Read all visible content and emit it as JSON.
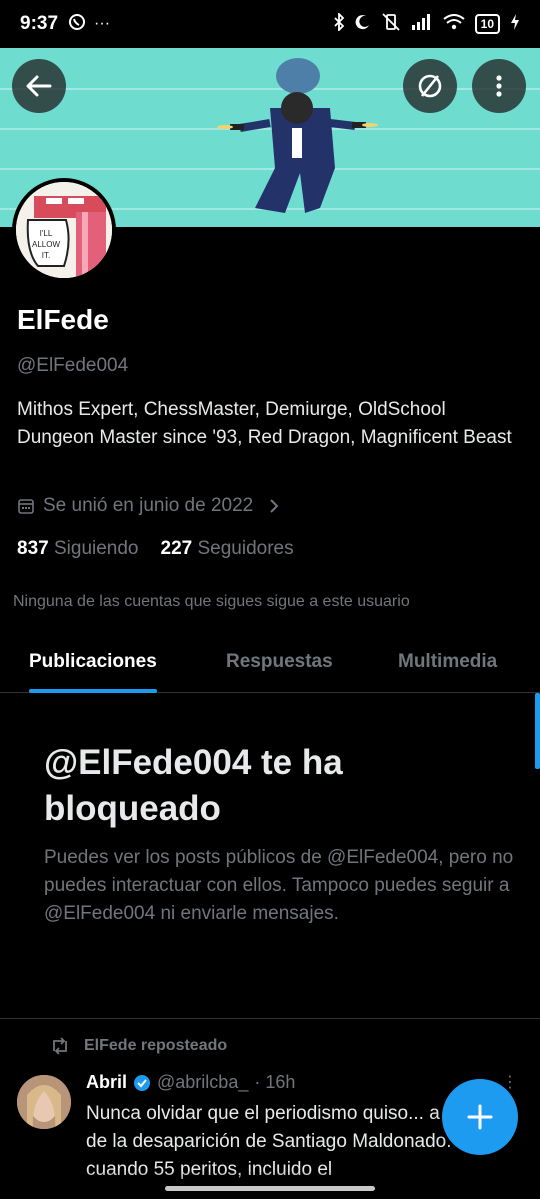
{
  "status_bar": {
    "time": "9:37",
    "left_icons": [
      "whatsapp-icon",
      "more-dots-icon"
    ],
    "right_icons": [
      "bluetooth-icon",
      "moon-icon",
      "mute-vibrate-icon",
      "signal-icon",
      "wifi-icon",
      "battery-icon",
      "charging-icon"
    ],
    "battery_level": "10"
  },
  "header": {
    "back_icon": "arrow-left-icon",
    "block_icon": "no-circle-icon",
    "more_icon": "more-vertical-icon"
  },
  "profile": {
    "avatar_text": "I'LL ALLOW IT.",
    "name": "ElFede",
    "handle": "@ElFede004",
    "bio": "Mithos Expert, ChessMaster, Demiurge, OldSchool Dungeon Master since '93, Red Dragon,  Magnificent Beast",
    "joined": "Se unió en junio de 2022",
    "following_count": "837",
    "following_label": "Siguiendo",
    "followers_count": "227",
    "followers_label": "Seguidores",
    "followers_you_know": "Ninguna de las cuentas que sigues sigue a este usuario"
  },
  "tabs": [
    {
      "label": "Publicaciones",
      "active": true
    },
    {
      "label": "Respuestas",
      "active": false
    },
    {
      "label": "Multimedia",
      "active": false
    }
  ],
  "blocked": {
    "title": "@ElFede004 te ha bloqueado",
    "text": "Puedes ver los posts públicos de @ElFede004, pero no puedes interactuar con ellos. Tampoco puedes seguir a @ElFede004 ni enviarle mensajes."
  },
  "post": {
    "repost_label": "ElFede reposteado",
    "author": "Abril",
    "verified": true,
    "handle": "@abrilcba_",
    "time": "· 16h",
    "text": "Nunca olvidar que el periodismo quiso... a Macri de la desaparición de Santiago Maldonado. Y cuando 55 peritos, incluido el"
  },
  "colors": {
    "accent": "#1d9bf0",
    "background": "#000000",
    "secondary_text": "#71767b",
    "banner": "#6fdcd0"
  }
}
